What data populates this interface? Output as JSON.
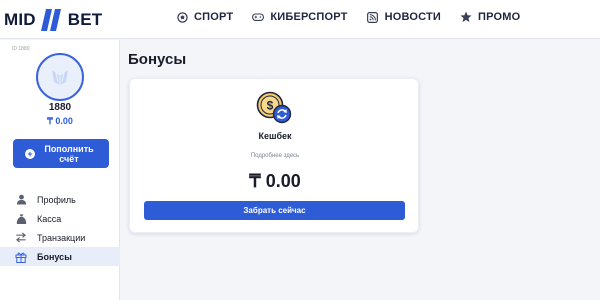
{
  "brand": {
    "left": "MID",
    "right": "BET",
    "accent": "#2e5bd6"
  },
  "nav": [
    {
      "label": "СПОРТ",
      "icon": "soccer-ball-icon"
    },
    {
      "label": "КИБЕРСПОРТ",
      "icon": "gamepad-icon"
    },
    {
      "label": "НОВОСТИ",
      "icon": "rss-icon"
    },
    {
      "label": "ПРОМО",
      "icon": "star-icon"
    }
  ],
  "sidebar": {
    "user_id": "ID 1880",
    "username": "1880",
    "balance": "₸ 0.00",
    "topup_label": "Пополнить счёт",
    "menu": [
      {
        "label": "Профиль",
        "icon": "user-icon"
      },
      {
        "label": "Касса",
        "icon": "money-bag-icon"
      },
      {
        "label": "Транзакции",
        "icon": "transfer-arrows-icon"
      },
      {
        "label": "Бонусы",
        "icon": "gift-icon",
        "active": true
      }
    ]
  },
  "main": {
    "title": "Бонусы",
    "card": {
      "icon": "cashback-coin-icon",
      "name": "Кешбек",
      "details_link": "Подробнее здесь",
      "amount": "₸ 0.00",
      "button_label": "Забрать сейчас"
    }
  }
}
